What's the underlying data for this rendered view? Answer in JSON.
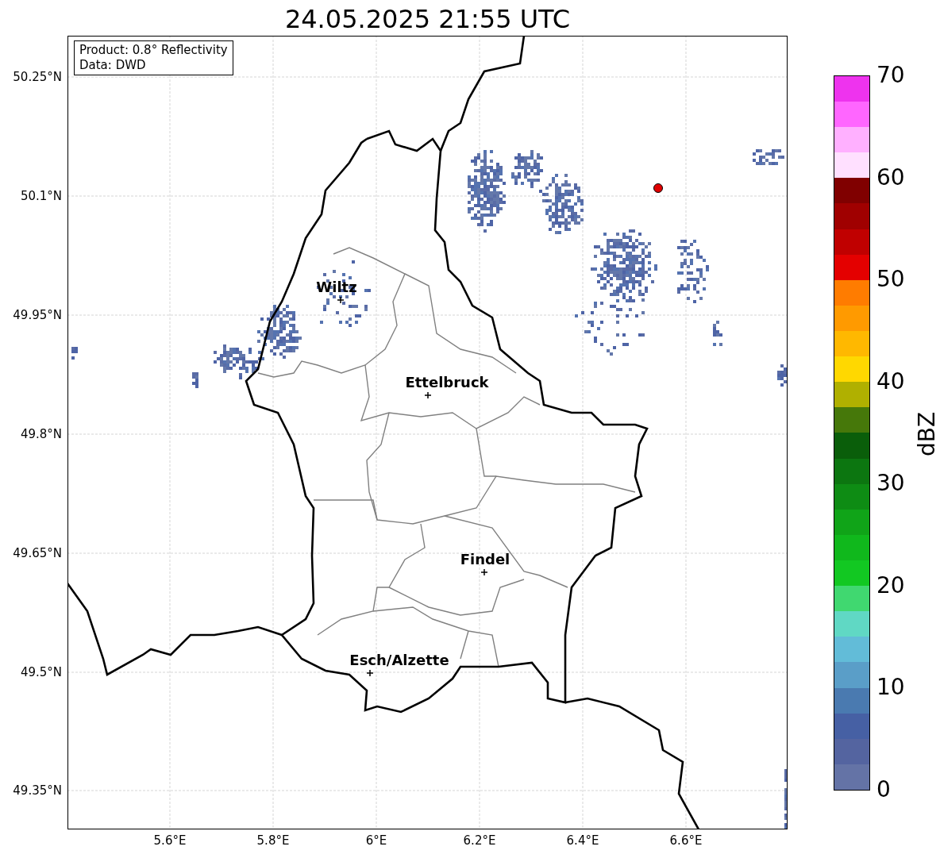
{
  "title": "24.05.2025 21:55 UTC",
  "info_box": [
    "Product: 0.8° Reflectivity",
    "Data: DWD"
  ],
  "y_ticks": [
    "50.25°N",
    "50.1°N",
    "49.95°N",
    "49.8°N",
    "49.65°N",
    "49.5°N",
    "49.35°N"
  ],
  "x_ticks": [
    "5.6°E",
    "5.8°E",
    "6°E",
    "6.2°E",
    "6.4°E",
    "6.6°E"
  ],
  "cities": [
    {
      "name": "Wiltz"
    },
    {
      "name": "Ettelbruck"
    },
    {
      "name": "Findel"
    },
    {
      "name": "Esch/Alzette"
    }
  ],
  "colorbar": {
    "label": "dBZ",
    "ticks": [
      "70",
      "60",
      "50",
      "40",
      "30",
      "20",
      "10",
      "0"
    ],
    "bands": [
      {
        "color": "#6473a6"
      },
      {
        "color": "#5464a0"
      },
      {
        "color": "#4660a4"
      },
      {
        "color": "#4a7ab0"
      },
      {
        "color": "#5a9ec8"
      },
      {
        "color": "#62bcd8"
      },
      {
        "color": "#60d8c4"
      },
      {
        "color": "#40d870"
      },
      {
        "color": "#12c822"
      },
      {
        "color": "#10b81c"
      },
      {
        "color": "#10a418"
      },
      {
        "color": "#0e8c14"
      },
      {
        "color": "#0c7610"
      },
      {
        "color": "#0a5e0a"
      },
      {
        "color": "#46780a"
      },
      {
        "color": "#b0b000"
      },
      {
        "color": "#ffd800"
      },
      {
        "color": "#ffb800"
      },
      {
        "color": "#ff9a00"
      },
      {
        "color": "#ff7c00"
      },
      {
        "color": "#e40000"
      },
      {
        "color": "#c00000"
      },
      {
        "color": "#a00000"
      },
      {
        "color": "#800000"
      },
      {
        "color": "#ffe0ff"
      },
      {
        "color": "#ffb0ff"
      },
      {
        "color": "#ff66ff"
      },
      {
        "color": "#ee33ee"
      }
    ]
  }
}
